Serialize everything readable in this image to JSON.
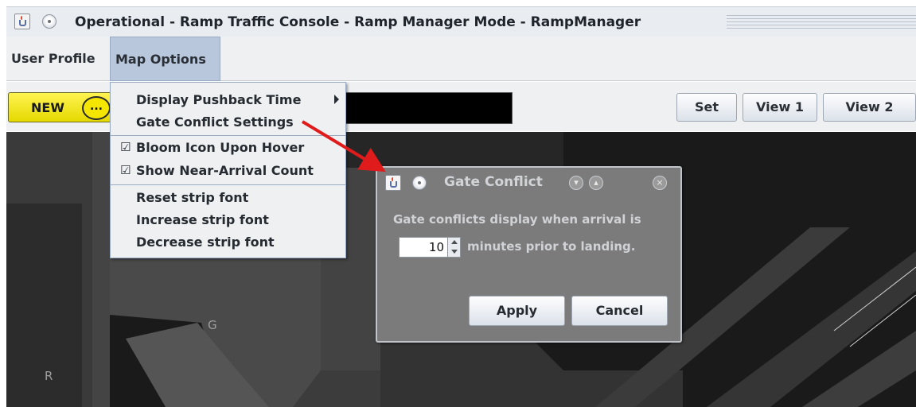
{
  "window": {
    "title": "Operational - Ramp Traffic Console - Ramp Manager Mode - RampManager"
  },
  "menubar": {
    "items": [
      {
        "label": "User Profile"
      },
      {
        "label": "Map Options"
      }
    ]
  },
  "toolbar": {
    "new_label": "NEW",
    "new_knob_label": "...",
    "set_label": "Set",
    "view1_label": "View 1",
    "view2_label": "View 2"
  },
  "map_options_menu": {
    "items": [
      {
        "label": "Display Pushback Time",
        "submenu": true
      },
      {
        "label": "Gate Conflict Settings"
      },
      {
        "label": "Bloom Icon Upon Hover",
        "checked": true
      },
      {
        "label": "Show Near-Arrival Count",
        "checked": true
      },
      {
        "label": "Reset strip font"
      },
      {
        "label": "Increase strip font"
      },
      {
        "label": "Decrease strip font"
      }
    ],
    "check_glyph": "☑"
  },
  "map": {
    "labels": [
      "G",
      "R"
    ]
  },
  "gate_conflict_dialog": {
    "title": "Gate Conflict",
    "message_line1": "Gate conflicts display when arrival is",
    "minutes_value": "10",
    "message_line2": "minutes prior to landing.",
    "apply_label": "Apply",
    "cancel_label": "Cancel"
  },
  "colors": {
    "new_button": "#f4e600",
    "annotation_arrow": "#e01b1b",
    "dialog_bg": "#7b7b7b",
    "map_bg": "#1a1a1a"
  }
}
